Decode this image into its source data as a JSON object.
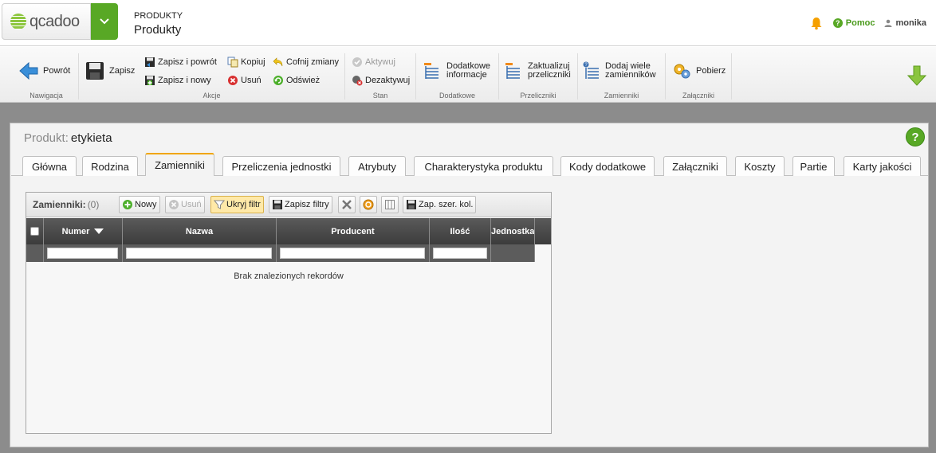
{
  "header": {
    "logo_text": "qcadoo",
    "section_small": "PRODUKTY",
    "section_big": "Produkty",
    "help_label": "Pomoc",
    "user_label": "monika"
  },
  "ribbon": {
    "groups": {
      "nawigacja": "Nawigacja",
      "akcje": "Akcje",
      "stan": "Stan",
      "dodatkowe": "Dodatkowe",
      "przeliczniki": "Przeliczniki",
      "zamienniki": "Zamienniki",
      "zalaczniki": "Załączniki"
    },
    "buttons": {
      "back": "Powrót",
      "save": "Zapisz",
      "save_back": "Zapisz i powrót",
      "save_new": "Zapisz i nowy",
      "copy": "Kopiuj",
      "delete": "Usuń",
      "undo": "Cofnij zmiany",
      "refresh": "Odśwież",
      "activate": "Aktywuj",
      "deactivate": "Dezaktywuj",
      "extra_info_1": "Dodatkowe",
      "extra_info_2": "informacje",
      "update_conv_1": "Zaktualizuj",
      "update_conv_2": "przeliczniki",
      "add_subst_1": "Dodaj wiele",
      "add_subst_2": "zamienników",
      "download": "Pobierz"
    }
  },
  "form": {
    "label": "Produkt:",
    "value": "etykieta"
  },
  "tabs": [
    {
      "label": "Główna"
    },
    {
      "label": "Rodzina"
    },
    {
      "label": "Zamienniki"
    },
    {
      "label": "Przeliczenia jednostki"
    },
    {
      "label": "Atrybuty"
    },
    {
      "label": "Charakterystyka produktu"
    },
    {
      "label": "Kody dodatkowe"
    },
    {
      "label": "Załączniki"
    },
    {
      "label": "Koszty"
    },
    {
      "label": "Partie"
    },
    {
      "label": "Karty jakości"
    }
  ],
  "active_tab": "Zamienniki",
  "grid": {
    "title": "Zamienniki:",
    "count": "(0)",
    "buttons": {
      "new": "Nowy",
      "delete": "Usuń",
      "hide_filter": "Ukryj filtr",
      "save_filters": "Zapisz filtry",
      "save_col_widths": "Zap. szer. kol."
    },
    "columns": [
      "Numer",
      "Nazwa",
      "Producent",
      "Ilość",
      "Jednostka"
    ],
    "sort_column": "Numer",
    "sort_direction": "desc",
    "empty_message": "Brak znalezionych rekordów"
  },
  "colors": {
    "brand_green": "#58a825",
    "active_tab_accent": "#f0a500",
    "workspace_gray": "#8c8c8c",
    "grid_header": "#4a4a4a"
  }
}
